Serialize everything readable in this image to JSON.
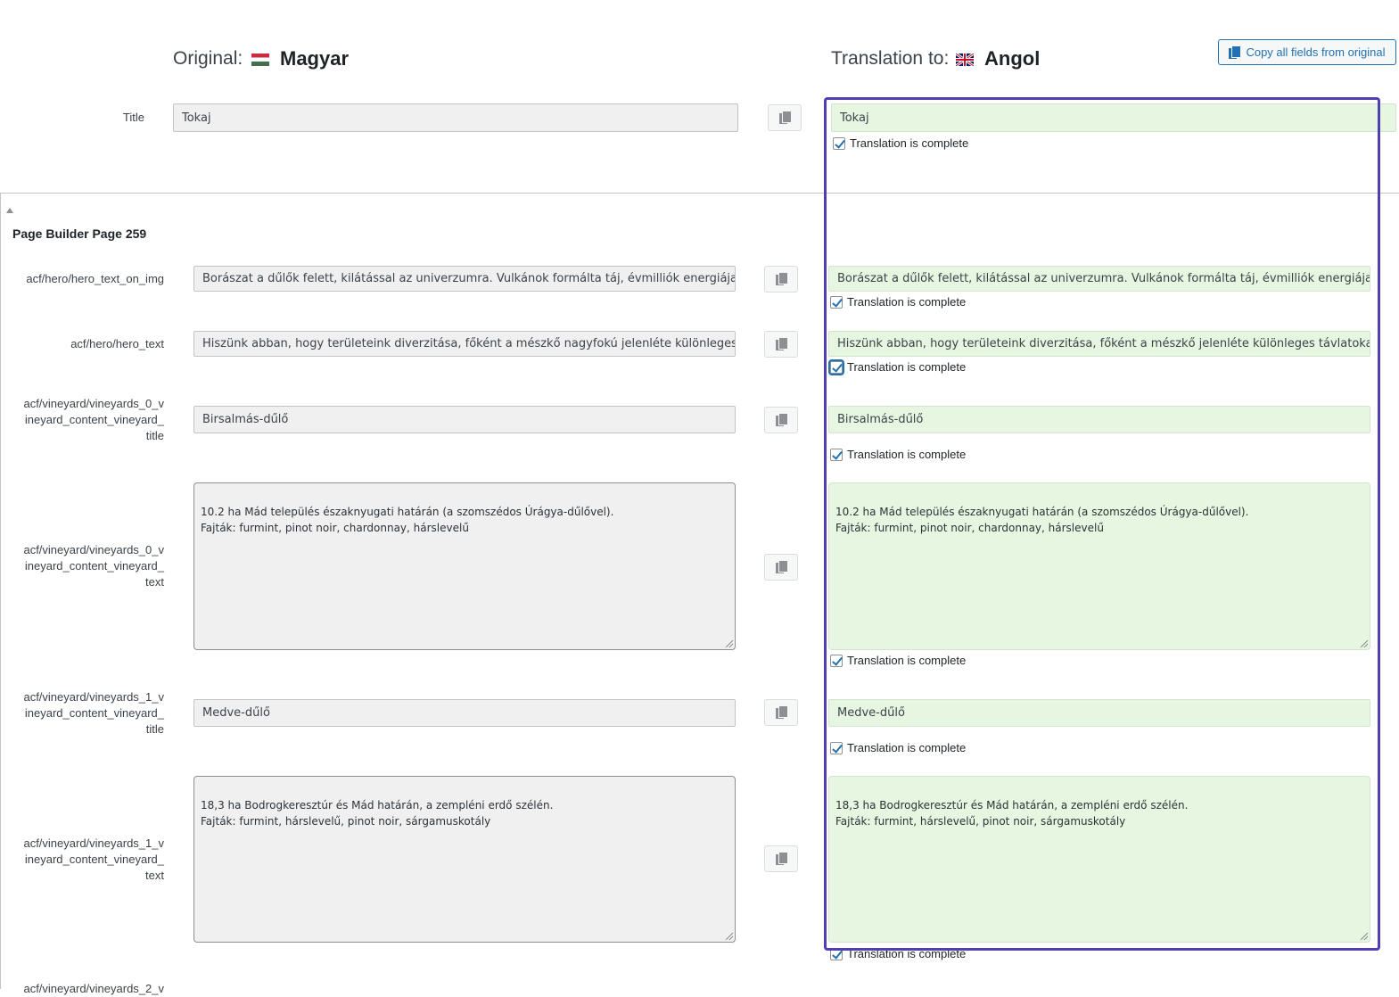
{
  "header": {
    "original_label": "Original:",
    "original_lang": "Magyar",
    "translation_label": "Translation to:",
    "translation_lang": "Angol",
    "copy_all_label": "Copy all fields from original"
  },
  "title_field": {
    "label": "Title",
    "original": "Tokaj",
    "translation": "Tokaj",
    "complete_label": "Translation is complete"
  },
  "section": {
    "title": "Page Builder Page 259"
  },
  "fields": [
    {
      "label": "acf/hero/hero_text_on_img",
      "original": "Borászat a dűlők felett, kilátással az univerzumra. Vulkánok formálta táj, évmilliók energiája minden talp",
      "translation": "Borászat a dűlők felett, kilátással az univerzumra. Vulkánok formálta táj, évmilliók energiája minden talp",
      "complete_label": "Translation is complete"
    },
    {
      "label": "acf/hero/hero_text",
      "original": "Hiszünk abban, hogy területeink diverzitása, főként a mészkő nagyfokú jelenléte különleges távlatokat r",
      "translation": "Hiszünk abban, hogy területeink diverzitása, főként a mészkő jelenléte különleges távlatokat nyit az aszú",
      "complete_label": "Translation is complete"
    },
    {
      "label_lines": [
        "acf/vineyard/vineyards_0_v",
        "ineyard_content_vineyard_",
        "title"
      ],
      "original": "Birsalmás-dűlő",
      "translation": "Birsalmás-dűlő",
      "complete_label": "Translation is complete"
    },
    {
      "label_lines": [
        "acf/vineyard/vineyards_0_v",
        "ineyard_content_vineyard_",
        "text"
      ],
      "original": "10.2 ha Mád település északnyugati határán (a szomszédos Úrágya-dűlővel).\nFajták: furmint, pinot noir, chardonnay, hárslevelű",
      "translation": "10.2 ha Mád település északnyugati határán (a szomszédos Úrágya-dűlővel).\nFajták: furmint, pinot noir, chardonnay, hárslevelű",
      "complete_label": "Translation is complete"
    },
    {
      "label_lines": [
        "acf/vineyard/vineyards_1_v",
        "ineyard_content_vineyard_",
        "title"
      ],
      "original": "Medve-dűlő",
      "translation": "Medve-dűlő",
      "complete_label": "Translation is complete"
    },
    {
      "label_lines": [
        "acf/vineyard/vineyards_1_v",
        "ineyard_content_vineyard_",
        "text"
      ],
      "original": "18,3 ha Bodrogkeresztúr és Mád határán, a zempléni erdő szélén.\nFajták: furmint, hárslevelű, pinot noir, sárgamuskotály",
      "translation": "18,3 ha Bodrogkeresztúr és Mád határán, a zempléni erdő szélén.\nFajták: furmint, hárslevelű, pinot noir, sárgamuskotály",
      "complete_label": "Translation is complete"
    }
  ],
  "partial_label": "acf/vineyard/vineyards_2_v",
  "colors": {
    "accent": "#2271b1",
    "highlight": "#4f3fb3",
    "translation_bg": "#e6f6e1"
  }
}
